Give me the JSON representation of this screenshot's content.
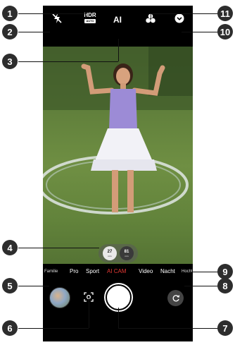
{
  "topbar": {
    "hdr_label": "HDR",
    "hdr_sub": "AUTO",
    "ai_label": "AI",
    "flash_icon": "flash-off-icon",
    "filters_icon": "three-circles-icon",
    "menu_icon": "chevron-down-circle-icon"
  },
  "zoom": {
    "left_value": "27",
    "left_unit": "mm",
    "right_value": "81",
    "right_unit": "mm"
  },
  "modes": {
    "items": [
      "Familie",
      "Pro",
      "Sport",
      "AI CAM",
      "Video",
      "Nacht",
      "Hochl"
    ],
    "active": "AI CAM"
  },
  "bottom": {
    "gallery_icon": "gallery-thumbnail",
    "lens_icon": "lens-scan-icon",
    "shutter_icon": "shutter-button",
    "switch_icon": "camera-switch-icon"
  },
  "callouts": [
    "1",
    "2",
    "3",
    "4",
    "5",
    "6",
    "7",
    "8",
    "9",
    "10",
    "11"
  ],
  "colors": {
    "accent": "#e53935",
    "callout_bg": "#2d2d2d"
  }
}
